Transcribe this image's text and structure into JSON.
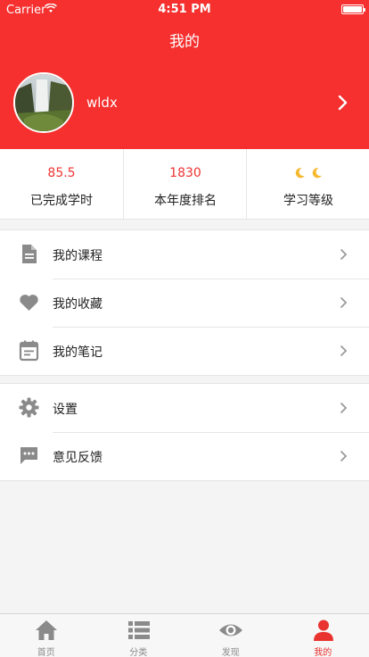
{
  "status_bar": {
    "carrier": "Carrier",
    "time": "4:51 PM"
  },
  "header": {
    "title": "我的",
    "username": "wldx"
  },
  "stats": [
    {
      "value": "85.5",
      "label": "已完成学时"
    },
    {
      "value": "1830",
      "label": "本年度排名"
    },
    {
      "value": "",
      "label": "学习等级",
      "icon": "moon-icon",
      "level_count": 2
    }
  ],
  "menu_group_1": [
    {
      "label": "我的课程",
      "icon": "document-icon"
    },
    {
      "label": "我的收藏",
      "icon": "heart-icon"
    },
    {
      "label": "我的笔记",
      "icon": "calendar-notes-icon"
    }
  ],
  "menu_group_2": [
    {
      "label": "设置",
      "icon": "gear-icon"
    },
    {
      "label": "意见反馈",
      "icon": "chat-feedback-icon"
    }
  ],
  "tabbar": [
    {
      "label": "首页",
      "icon": "home-icon"
    },
    {
      "label": "分类",
      "icon": "list-icon"
    },
    {
      "label": "发现",
      "icon": "eye-icon"
    },
    {
      "label": "我的",
      "icon": "person-icon",
      "active": true
    }
  ],
  "colors": {
    "primary": "#f5302f",
    "icon_gray": "#8a8a8a",
    "stat_value": "#e33333",
    "moon": "#f5b82e",
    "background": "#f4f4f4"
  }
}
